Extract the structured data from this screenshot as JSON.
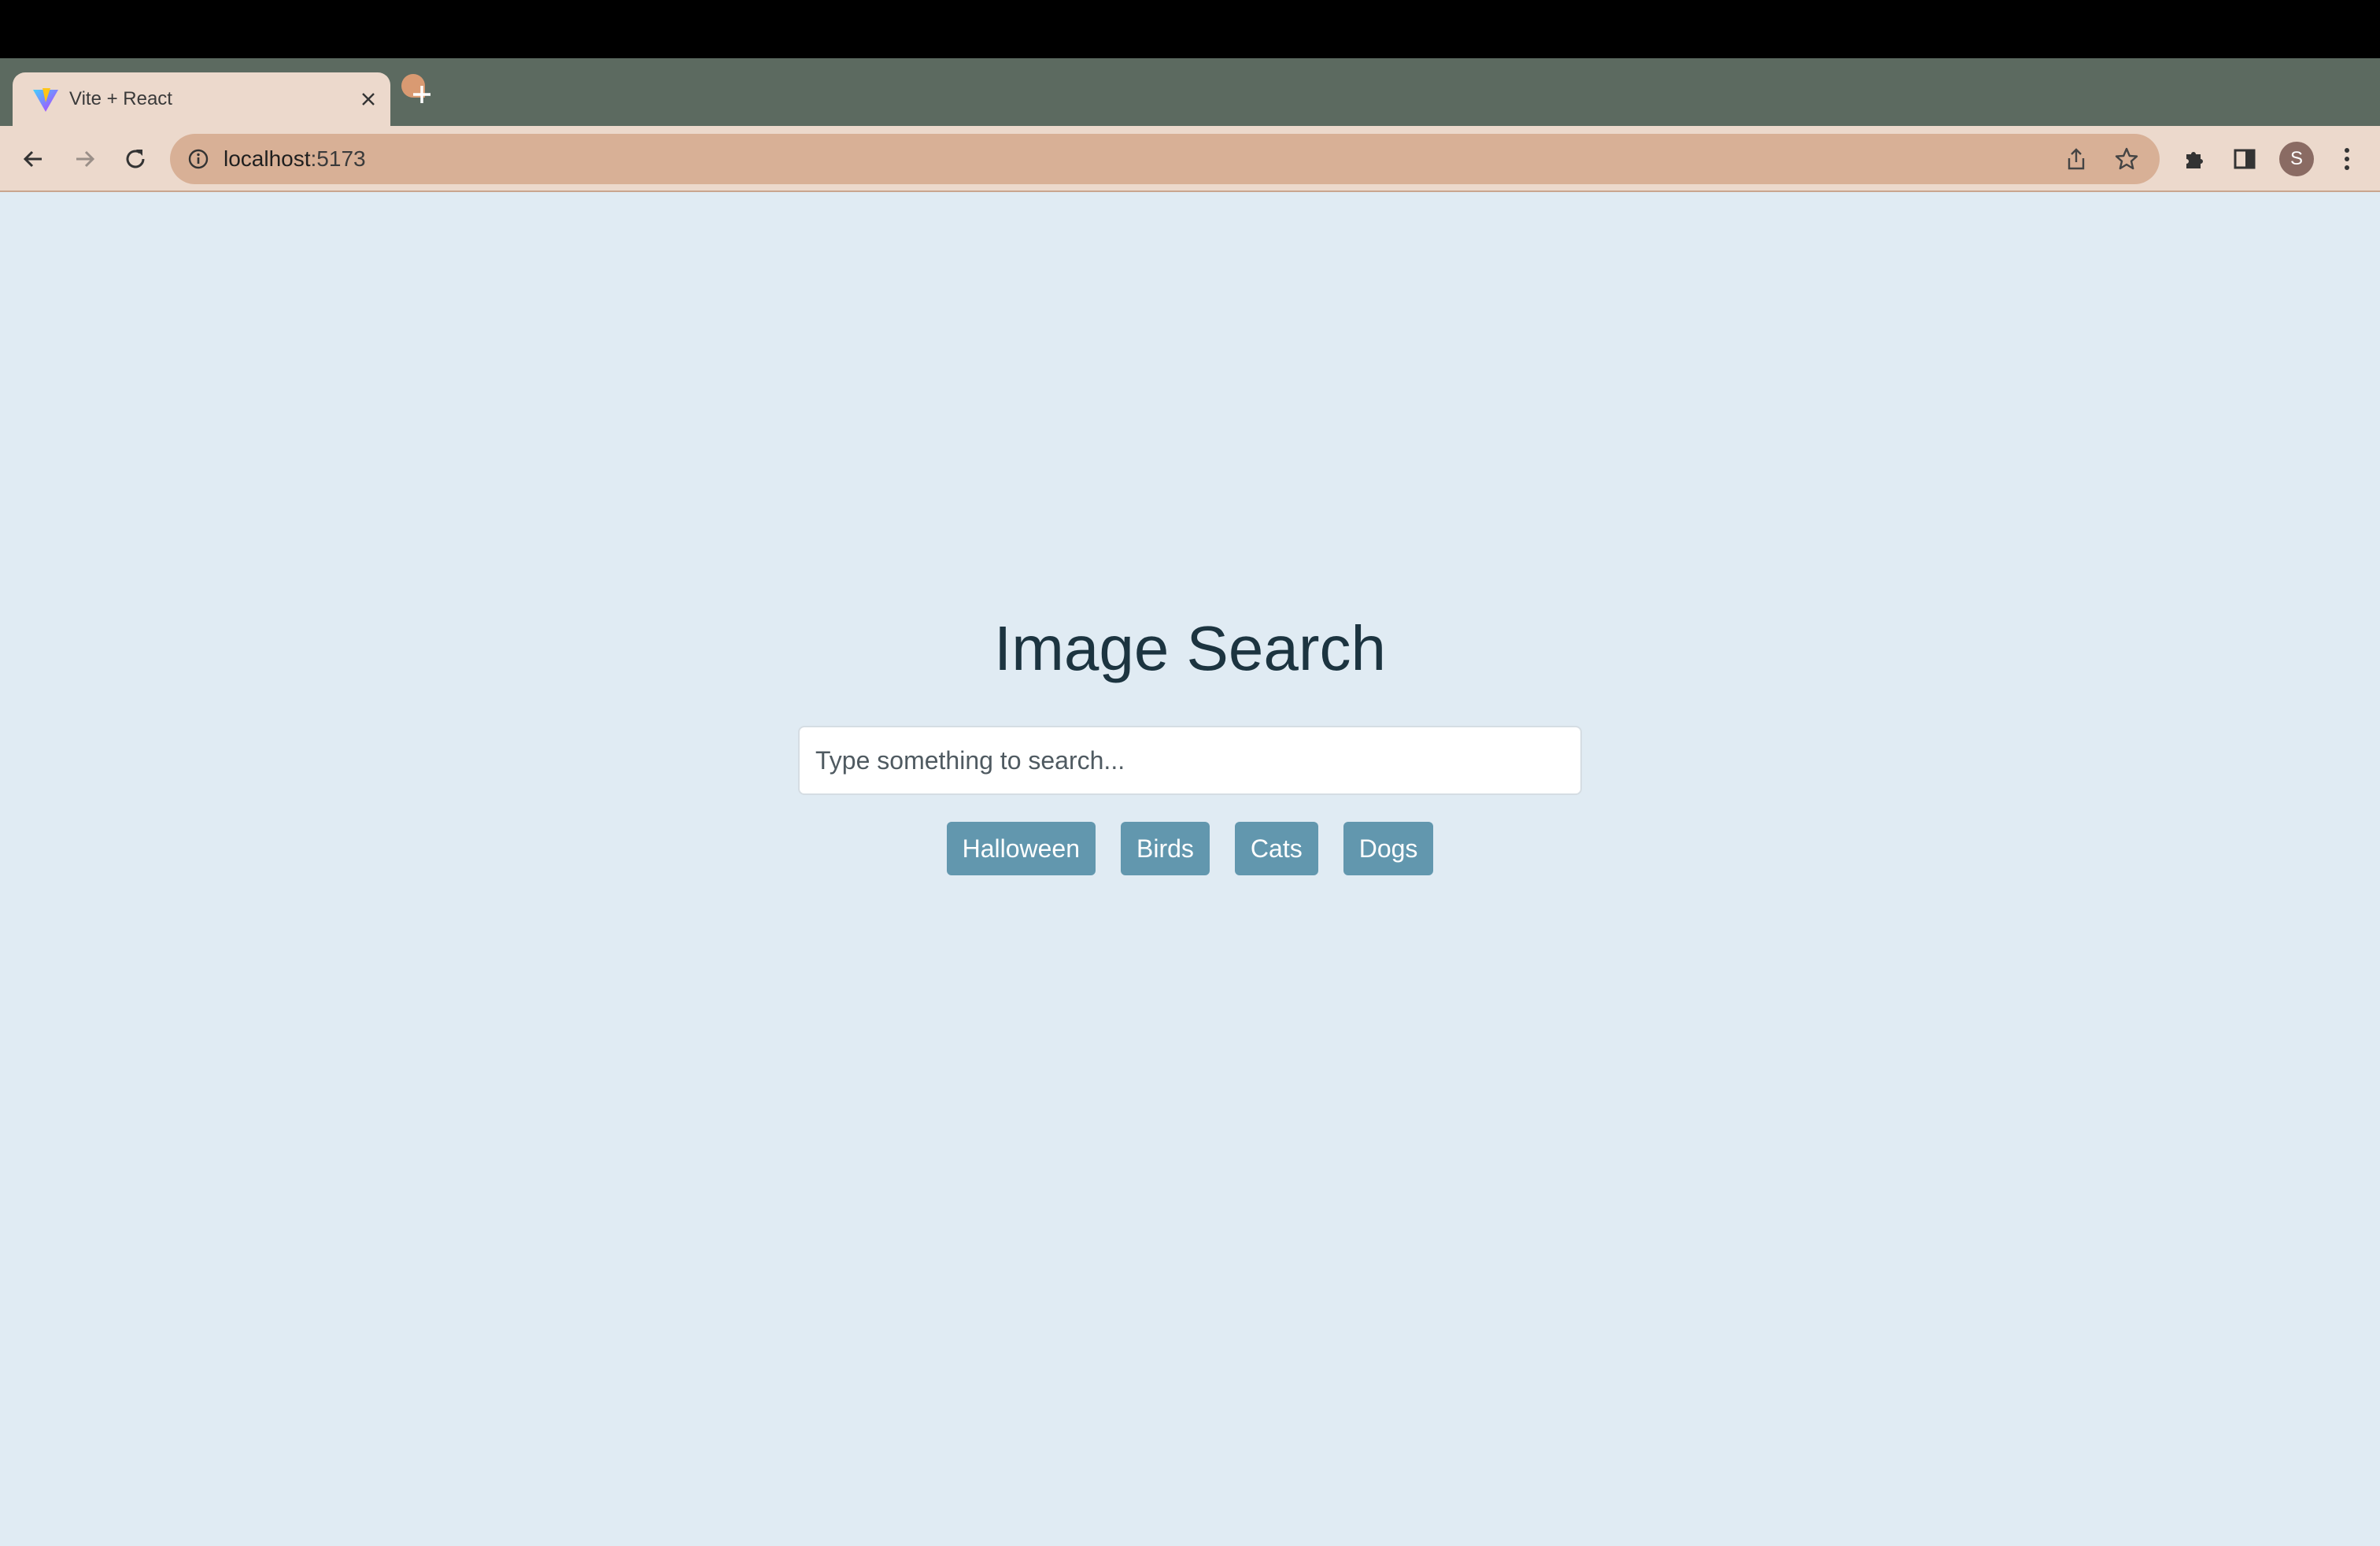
{
  "browser": {
    "tab": {
      "title": "Vite + React",
      "favicon": "vite-logo-icon"
    },
    "url": {
      "host": "localhost",
      "port": ":5173"
    },
    "profile_initial": "S"
  },
  "page": {
    "title": "Image Search",
    "search": {
      "placeholder": "Type something to search...",
      "value": ""
    },
    "chips": [
      "Halloween",
      "Birds",
      "Cats",
      "Dogs"
    ]
  },
  "colors": {
    "background": "#e0ebf3",
    "chip": "#6297ae",
    "title": "#1c3440",
    "tab_strip": "#5c6a60",
    "toolbar": "#ecd9cc",
    "omnibox": "#d8b096"
  }
}
